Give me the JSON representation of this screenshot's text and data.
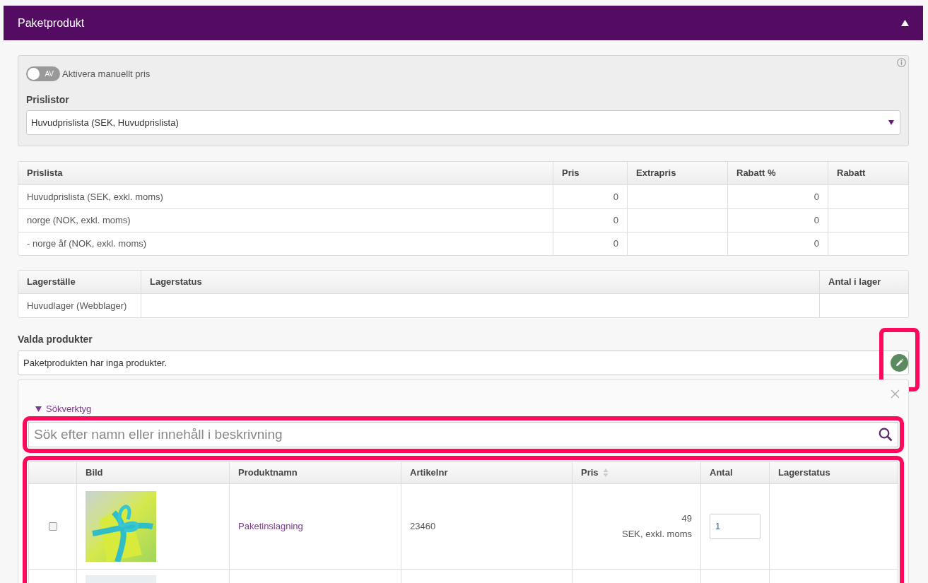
{
  "panel": {
    "title": "Paketprodukt",
    "expanded": true
  },
  "manual_price": {
    "on": false,
    "toggle_text": "AV",
    "label": "Aktivera manuellt pris"
  },
  "price_lists": {
    "label": "Prislistor",
    "value": "Huvudprislista (SEK, Huvudprislista)"
  },
  "price_table": {
    "columns": [
      "Prislista",
      "Pris",
      "Extrapris",
      "Rabatt %",
      "Rabatt"
    ],
    "rows": [
      [
        "Huvudprislista (SEK, exkl. moms)",
        "0",
        "",
        "0",
        ""
      ],
      [
        "norge (NOK, exkl. moms)",
        "0",
        "",
        "0",
        ""
      ],
      [
        "- norge åf (NOK, exkl. moms)",
        "0",
        "",
        "0",
        ""
      ]
    ]
  },
  "stock_table": {
    "columns": [
      "Lagerställe",
      "Lagerstatus",
      "Antal i lager"
    ],
    "rows": [
      [
        "Huvudlager (Webblager)",
        "",
        ""
      ]
    ]
  },
  "selected_products": {
    "label": "Valda produkter",
    "text": "Paketprodukten har inga produkter.",
    "highlighted": true
  },
  "search_tools": {
    "label": "Sökverktyg",
    "expanded": true,
    "placeholder": "Sök efter namn eller innehåll i beskrivning",
    "highlighted": true
  },
  "results": {
    "highlighted": true,
    "columns": [
      {
        "sortable": false
      },
      {
        "label": "Bild",
        "sortable": false
      },
      {
        "label": "Produktnamn",
        "sortable": false
      },
      {
        "label": "Artikelnr",
        "sortable": false
      },
      {
        "label": "Pris",
        "sortable": true
      },
      {
        "label": "Antal",
        "sortable": false
      },
      {
        "label": "Lagerstatus",
        "sortable": false
      }
    ],
    "rows": [
      {
        "kind": "product",
        "checked": false,
        "name": "Paketinslagning",
        "sku": "23460",
        "price": "49",
        "price_note": "SEK, exkl. moms",
        "quantity": "1"
      },
      {
        "kind": "partial"
      }
    ]
  }
}
